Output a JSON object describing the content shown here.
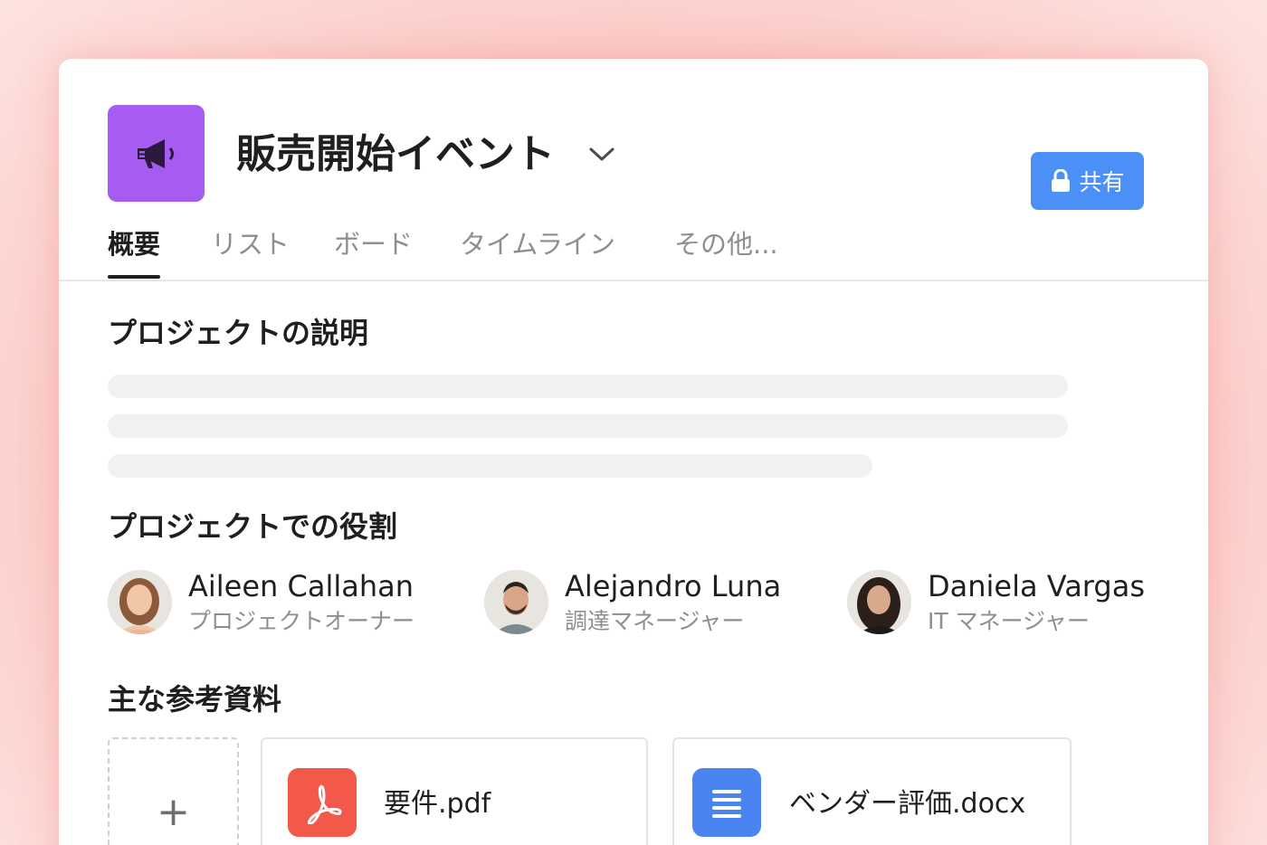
{
  "project": {
    "title": "販売開始イベント",
    "icon": "megaphone-icon",
    "icon_color": "#a65cf0"
  },
  "share_button": {
    "label": "共有",
    "icon": "lock-icon",
    "color": "#4a90f7"
  },
  "tabs": [
    {
      "label": "概要",
      "active": true
    },
    {
      "label": "リスト",
      "active": false
    },
    {
      "label": "ボード",
      "active": false
    },
    {
      "label": "タイムライン",
      "active": false
    },
    {
      "label": "その他...",
      "active": false
    }
  ],
  "description": {
    "title": "プロジェクトの説明"
  },
  "roles": {
    "title": "プロジェクトでの役割",
    "members": [
      {
        "name": "Aileen Callahan",
        "role": "プロジェクトオーナー"
      },
      {
        "name": "Alejandro Luna",
        "role": "調達マネージャー"
      },
      {
        "name": "Daniela Vargas",
        "role": "IT マネージャー"
      }
    ]
  },
  "resources": {
    "title": "主な参考資料",
    "add_label": "+",
    "files": [
      {
        "name": "要件.pdf",
        "icon": "pdf-icon",
        "icon_color": "#f2594b"
      },
      {
        "name": "ベンダー評価.docx",
        "icon": "document-icon",
        "icon_color": "#4a84f0"
      }
    ]
  }
}
